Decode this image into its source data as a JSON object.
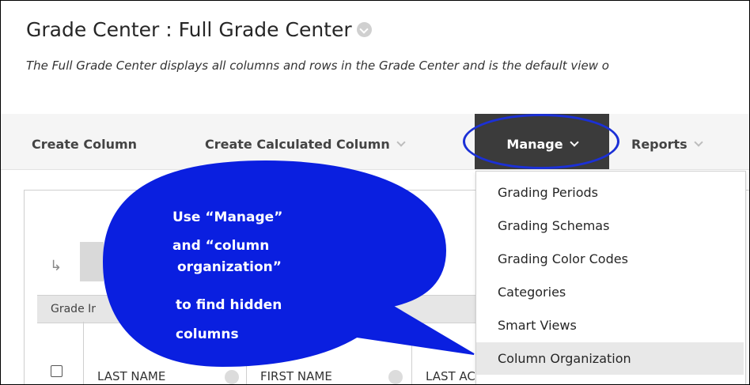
{
  "header": {
    "title": "Grade Center : Full Grade Center",
    "description": "The Full Grade Center displays all columns and rows in the Grade Center and is the default view o"
  },
  "toolbar": {
    "create_column": "Create Column",
    "create_calculated_column": "Create Calculated Column",
    "manage": "Manage",
    "reports": "Reports"
  },
  "manage_menu": {
    "items": [
      "Grading Periods",
      "Grading Schemas",
      "Grading Color Codes",
      "Categories",
      "Smart Views",
      "Column Organization"
    ]
  },
  "grid": {
    "info_label": "Grade Ir",
    "columns": [
      "LAST NAME",
      "FIRST NAME",
      "LAST AC"
    ]
  },
  "callout": {
    "line1": "Use “Manage”",
    "line2": "and “column",
    "line3": "organization”",
    "line4": "to find hidden",
    "line5": "columns",
    "color": "#0a1fe0"
  }
}
